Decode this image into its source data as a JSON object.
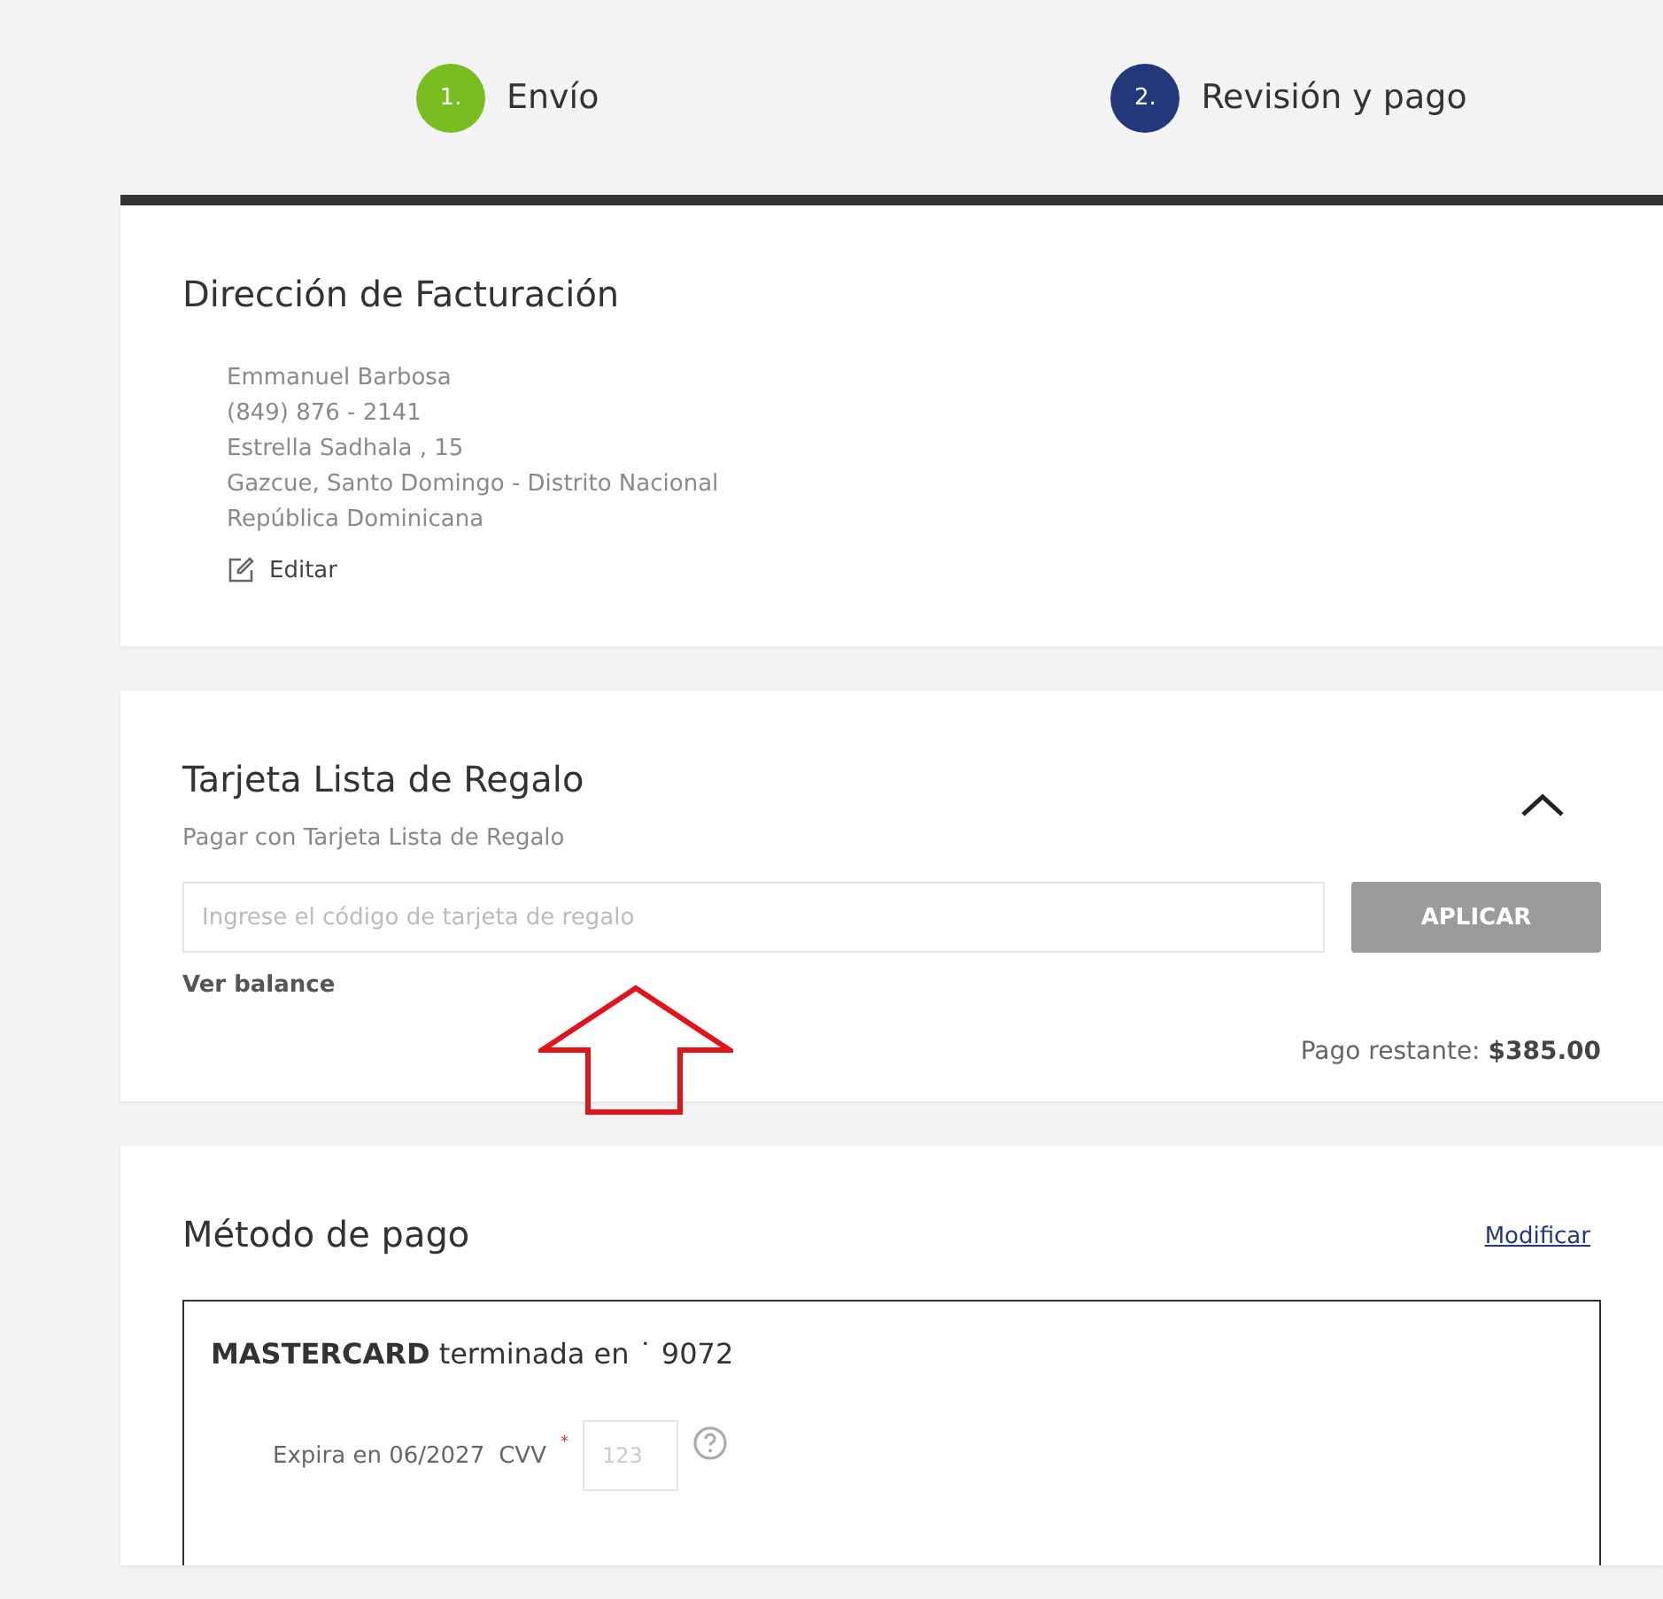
{
  "steps": [
    {
      "number": "1.",
      "label": "Envío",
      "color": "#78be20"
    },
    {
      "number": "2.",
      "label": "Revisión y pago",
      "color": "#22387a"
    }
  ],
  "billing": {
    "title": "Dirección de Facturación",
    "lines": [
      "Emmanuel Barbosa",
      "(849) 876 - 2141",
      "Estrella Sadhala , 15",
      "Gazcue, Santo Domingo - Distrito Nacional",
      "República Dominicana"
    ],
    "edit": "Editar"
  },
  "gift_card": {
    "title": "Tarjeta Lista de Regalo",
    "subtitle": "Pagar con Tarjeta Lista de Regalo",
    "expanded": true,
    "placeholder": "Ingrese el código de tarjeta de regalo",
    "apply": "APLICAR",
    "balance_link": "Ver balance",
    "remaining_label": "Pago restante:",
    "remaining_amount": "$385.00"
  },
  "payment": {
    "title": "Método de pago",
    "modify": "Modificar",
    "card_brand": "MASTERCARD",
    "card_text": "terminada en ˙ 9072",
    "expiry": "Expira en 06/2027",
    "cvv_label": "CVV",
    "required_mark": "*",
    "cvv_placeholder": "123"
  }
}
